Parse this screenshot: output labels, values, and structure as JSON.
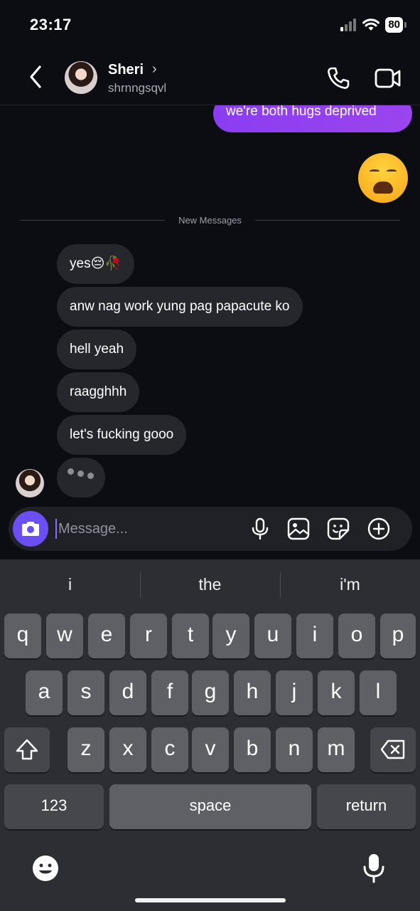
{
  "status_bar": {
    "time": "23:17",
    "battery": "80"
  },
  "header": {
    "name": "Sheri",
    "username": "shrnngsqvl"
  },
  "messages": {
    "outgoing_text": "we're both hugs deprived",
    "divider_label": "New Messages",
    "incoming": [
      "yes😔🥀",
      "anw nag work yung pag papacute ko",
      "hell yeah",
      "raagghhh",
      "let's fucking gooo"
    ]
  },
  "composer": {
    "placeholder": "Message..."
  },
  "keyboard": {
    "suggestions": [
      "i",
      "the",
      "i'm"
    ],
    "row1": [
      "q",
      "w",
      "e",
      "r",
      "t",
      "y",
      "u",
      "i",
      "o",
      "p"
    ],
    "row2": [
      "a",
      "s",
      "d",
      "f",
      "g",
      "h",
      "j",
      "k",
      "l"
    ],
    "row3": [
      "z",
      "x",
      "c",
      "v",
      "b",
      "n",
      "m"
    ],
    "numbers_key": "123",
    "space_key": "space",
    "return_key": "return"
  },
  "icons": {
    "back": "chevron-left-icon",
    "call": "phone-icon",
    "video": "video-camera-icon",
    "camera": "camera-icon",
    "mic": "microphone-icon",
    "gallery": "image-icon",
    "sticker": "sticker-icon",
    "plus": "plus-circle-icon"
  },
  "colors": {
    "accent": "#8a3df0",
    "camera_button": "#6b4ff5",
    "incoming_bubble": "#25272d"
  }
}
